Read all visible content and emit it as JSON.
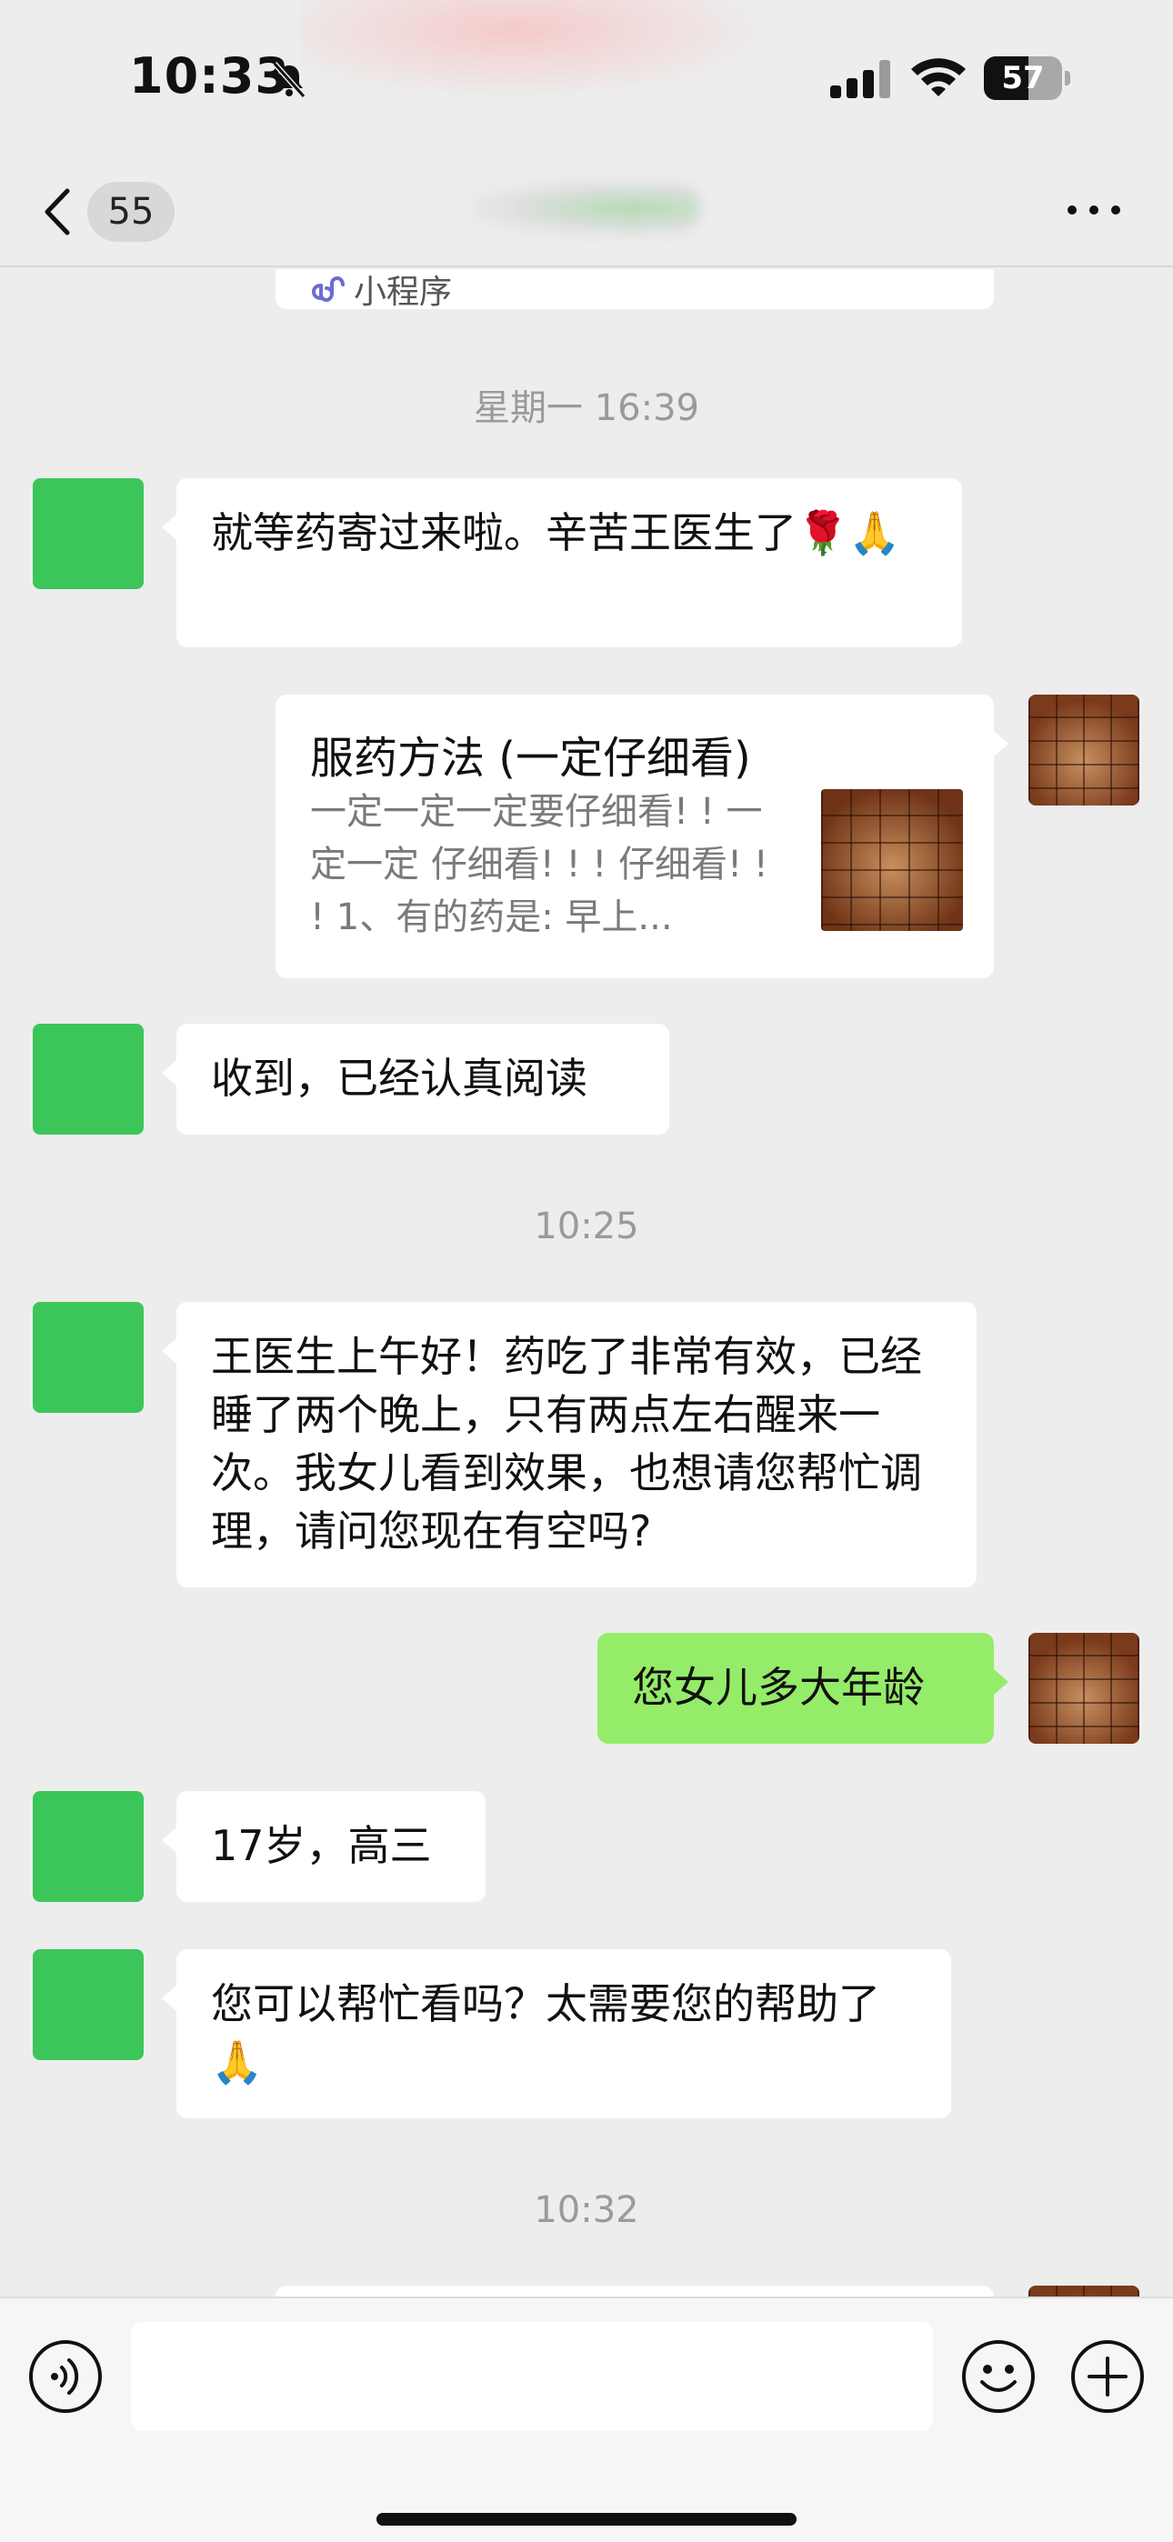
{
  "status_bar": {
    "time": "10:33",
    "battery": "57",
    "battery_level": 0.57,
    "icons": [
      "bell-slash-icon",
      "cellular-signal-icon",
      "wifi-icon",
      "battery-icon"
    ]
  },
  "header": {
    "unread_count": "55",
    "icons": [
      "chevron-left-icon",
      "more-dots-icon"
    ]
  },
  "colors": {
    "background": "#ededed",
    "sent_bubble": "#95ec69",
    "received_bubble": "#ffffff",
    "avatar_green": "#3cc65a",
    "timestamp": "#9a9a9a"
  },
  "chat": {
    "mini_program_label": "小程序",
    "timestamps": [
      "星期一 16:39",
      "10:25",
      "10:32"
    ],
    "messages": [
      {
        "side": "left",
        "text": "就等药寄过来啦。辛苦王医生了🌹🙏"
      },
      {
        "side": "right",
        "type": "article",
        "title": "服药方法 (一定仔细看)",
        "description": "一定一定一定要仔细看! ! 一定一定 仔细看! ! ! 仔细看! ! ! 1、有的药是: 早上..."
      },
      {
        "side": "left",
        "text": "收到，已经认真阅读"
      },
      {
        "side": "left",
        "text": "王医生上午好！药吃了非常有效，已经睡了两个晚上，只有两点左右醒来一次。我女儿看到效果，也想请您帮忙调理，请问您现在有空吗?"
      },
      {
        "side": "right",
        "text": "您女儿多大年龄"
      },
      {
        "side": "left",
        "text": "17岁，高三"
      },
      {
        "side": "left",
        "text": "您可以帮忙看吗？太需要您的帮助了🙏"
      }
    ]
  },
  "input_bar": {
    "text_value": "",
    "icons": [
      "voice-icon",
      "emoji-icon",
      "plus-icon"
    ]
  }
}
